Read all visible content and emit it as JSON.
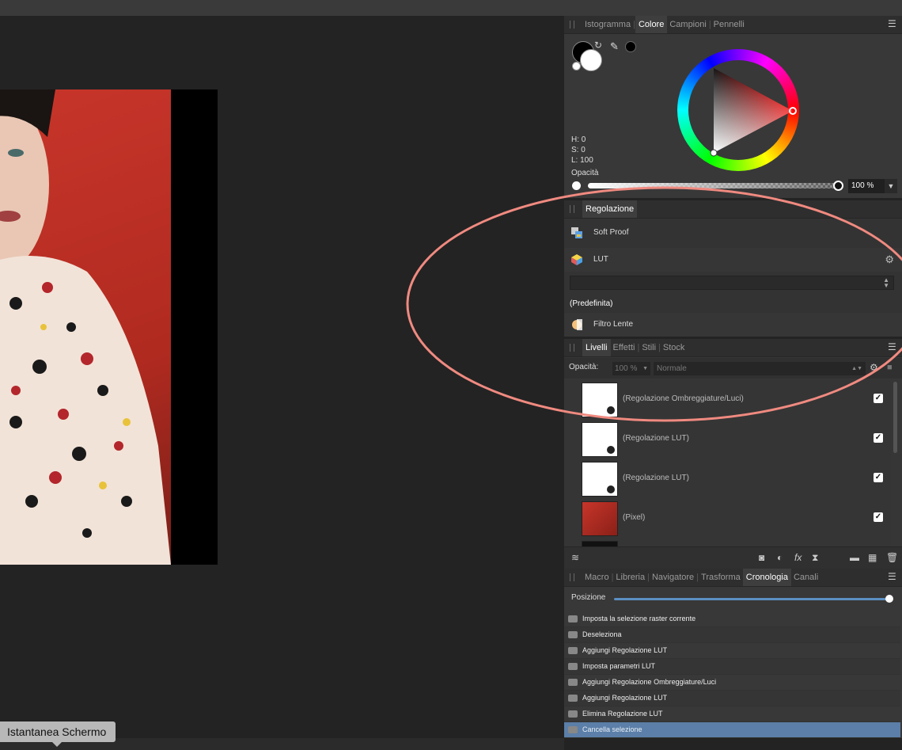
{
  "tooltip": "Istantanea Schermo",
  "color_panel": {
    "tabs": [
      "Istogramma",
      "Colore",
      "Campioni",
      "Pennelli"
    ],
    "active_tab": "Colore",
    "h": "H: 0",
    "s": "S: 0",
    "l": "L: 100",
    "opacity_label": "Opacità",
    "opacity_value": "100 %",
    "opacity_fraction": 1.0
  },
  "adjust_panel": {
    "tab": "Regolazione",
    "items": [
      "Soft Proof",
      "LUT",
      "Filtro Lente"
    ],
    "preset": "(Predefinita)"
  },
  "layers_panel": {
    "tabs": [
      "Livelli",
      "Effetti",
      "Stili",
      "Stock"
    ],
    "active_tab": "Livelli",
    "opacity_label": "Opacità:",
    "opacity_value": "100 %",
    "blend_mode": "Normale",
    "layers": [
      {
        "name": "(Regolazione Ombreggiature/Luci)",
        "checked": "✓"
      },
      {
        "name": "(Regolazione LUT)",
        "checked": "✓"
      },
      {
        "name": "(Regolazione LUT)",
        "checked": "✓"
      },
      {
        "name": "(Pixel)",
        "checked": "✓"
      }
    ]
  },
  "history_panel": {
    "tabs": [
      "Macro",
      "Libreria",
      "Navigatore",
      "Trasforma",
      "Cronologia",
      "Canali"
    ],
    "active_tab": "Cronologia",
    "position_label": "Posizione",
    "position_fraction": 1.0,
    "items": [
      "Imposta la selezione raster corrente",
      "Deseleziona",
      "Aggiungi Regolazione LUT",
      "Imposta parametri LUT",
      "Aggiungi Regolazione Ombreggiature/Luci",
      "Aggiungi Regolazione LUT",
      "Elimina Regolazione LUT",
      "Cancella selezione"
    ],
    "selected_index": 7
  },
  "colors": {
    "annotation": "#f08a80",
    "selection": "#5b7fa8",
    "accent": "#5b8fc2"
  }
}
